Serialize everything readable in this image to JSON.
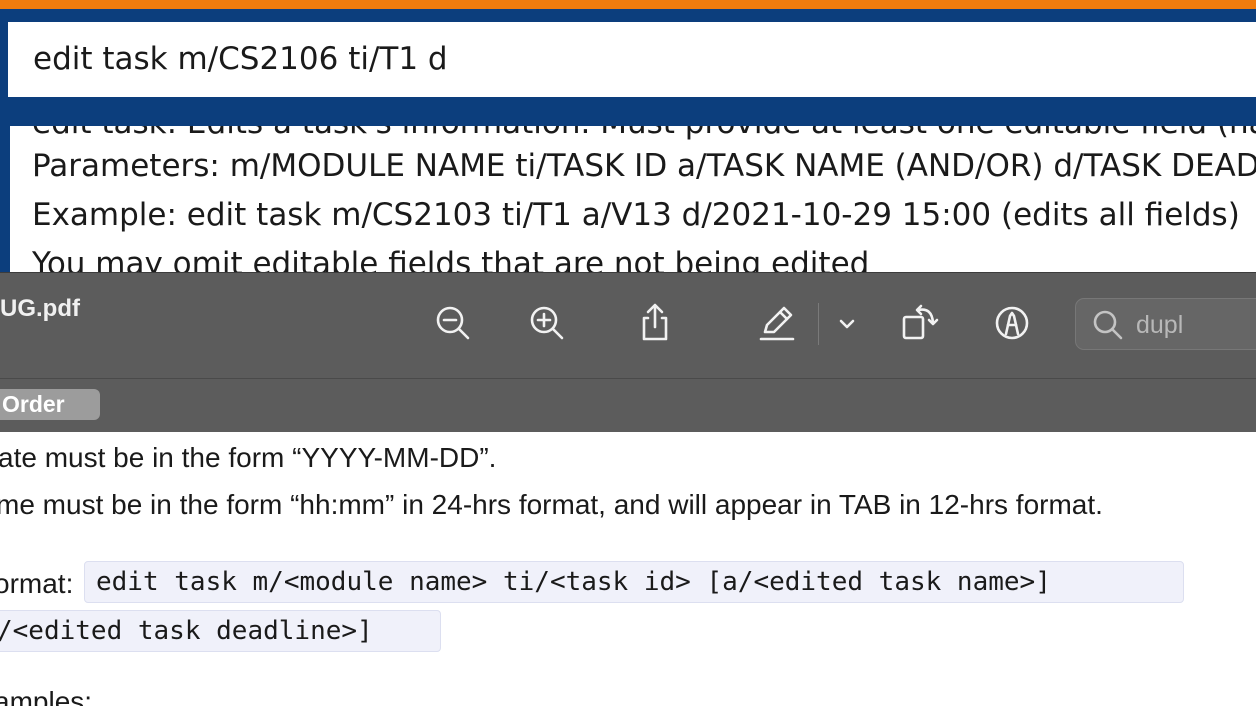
{
  "app": {
    "accent_color": "#f07c0d",
    "command_input": "edit task m/CS2106 ti/T1 d",
    "result_lines": [
      "edit task: Edits a task's information. Must provide at least one editable field (name",
      "Parameters: m/MODULE NAME ti/TASK ID a/TASK NAME (AND/OR) d/TASK DEADLINE",
      "Example: edit task m/CS2103 ti/T1 a/V13 d/2021-10-29 15:00 (edits all fields)",
      "You may omit editable fields that are not being edited"
    ]
  },
  "pdf_viewer": {
    "title": "UG.pdf",
    "toolbar_icons": [
      "zoom-out-icon",
      "zoom-in-icon",
      "share-icon",
      "highlight-pen-icon",
      "chevron-down-icon",
      "rotate-icon",
      "markup-icon"
    ],
    "search_value": "dupl",
    "order_label": "Order"
  },
  "pdf_page": {
    "line_date": "ate must be in the form “YYYY-MM-DD”.",
    "line_time": "me must be in the form “hh:mm” in 24-hrs format, and will appear in TAB in 12-hrs format.",
    "format_prefix": "ormat:",
    "format_code_1": "edit task m/<module name> ti/<task id> [a/<edited task name>]",
    "format_code_2": "/<edited task deadline>]",
    "examples_heading": "amples:"
  }
}
